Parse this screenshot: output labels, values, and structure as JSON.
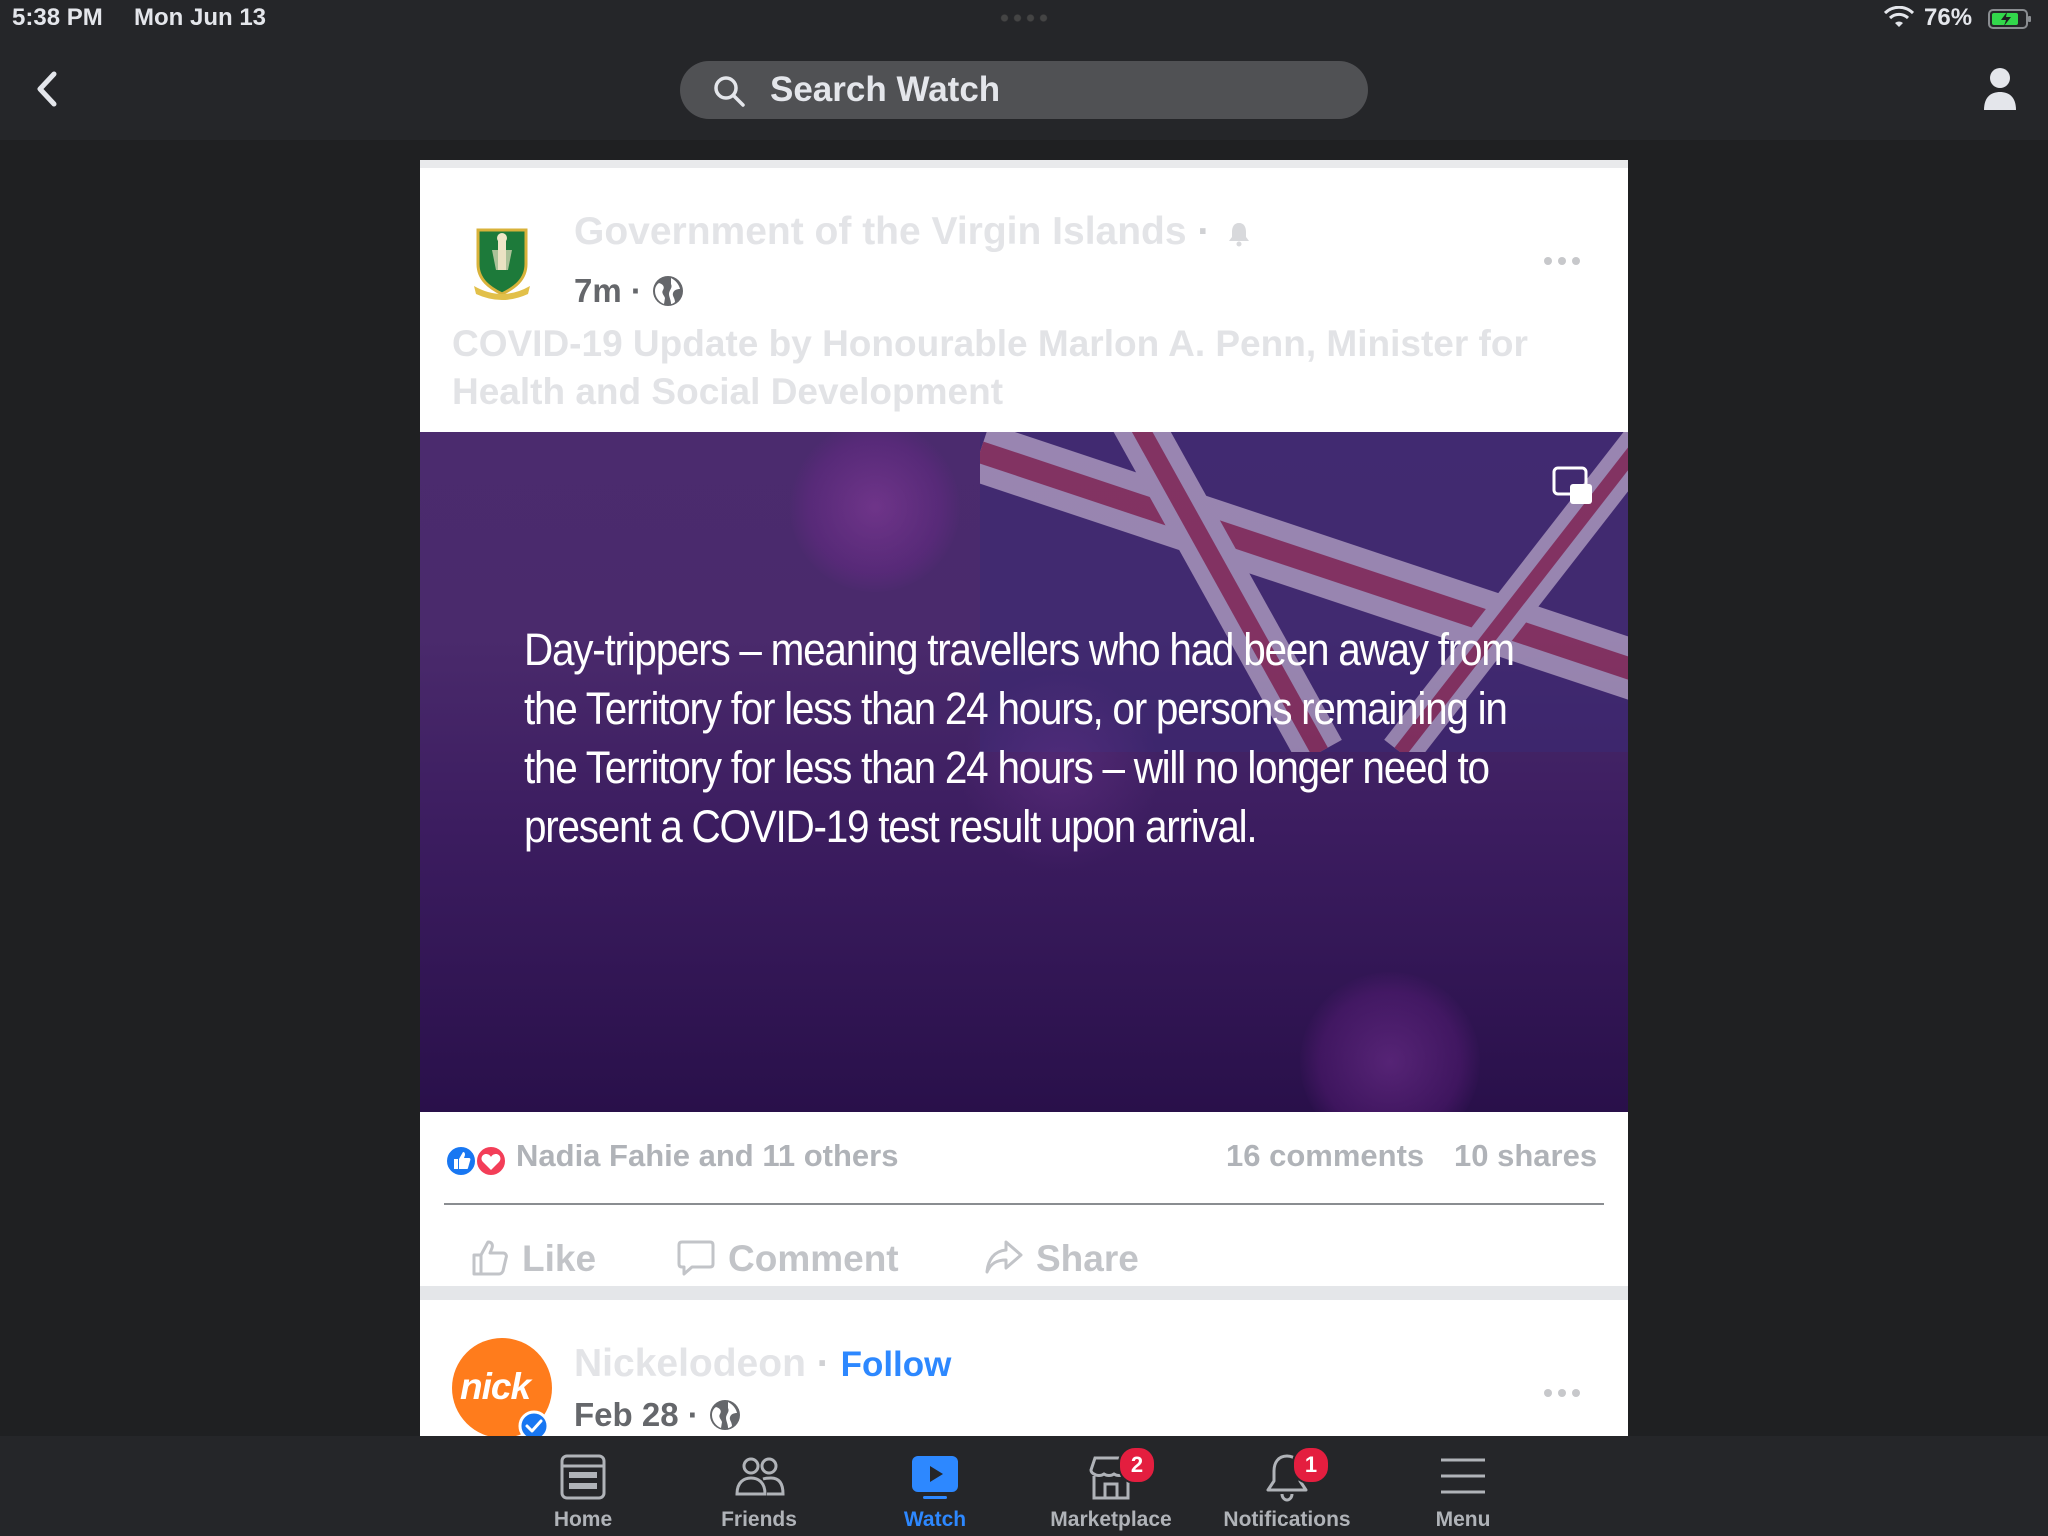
{
  "status_bar": {
    "time": "5:38 PM",
    "date": "Mon Jun 13",
    "battery": "76%"
  },
  "top_bar": {
    "search_placeholder": "Search Watch"
  },
  "post": {
    "page_name": "Government of the Virgin Islands",
    "separator": "·",
    "time": "7m",
    "caption": "COVID-19 Update by Honourable Marlon A. Penn, Minister for Health and Social Development",
    "video_text": "Day-trippers – meaning travellers who had been away from the Territory for less than 24 hours, or persons remaining in the Territory for less than 24 hours – will no longer need to present a COVID-19 test result upon arrival.",
    "reactions": "Nadia Fahie and 11 others",
    "comments": "16 comments",
    "shares": "10 shares",
    "actions": {
      "like": "Like",
      "comment": "Comment",
      "share": "Share"
    }
  },
  "post2": {
    "page_name": "Nickelodeon",
    "separator": "·",
    "follow": "Follow",
    "date": "Feb 28",
    "logo_text": "nick"
  },
  "bottom_nav": {
    "tabs": [
      {
        "label": "Home"
      },
      {
        "label": "Friends"
      },
      {
        "label": "Watch"
      },
      {
        "label": "Marketplace",
        "badge": "2"
      },
      {
        "label": "Notifications",
        "badge": "1"
      },
      {
        "label": "Menu"
      }
    ]
  },
  "colors": {
    "accent": "#2d88ff",
    "badge": "#e41e3f",
    "background": "#1f2022"
  }
}
